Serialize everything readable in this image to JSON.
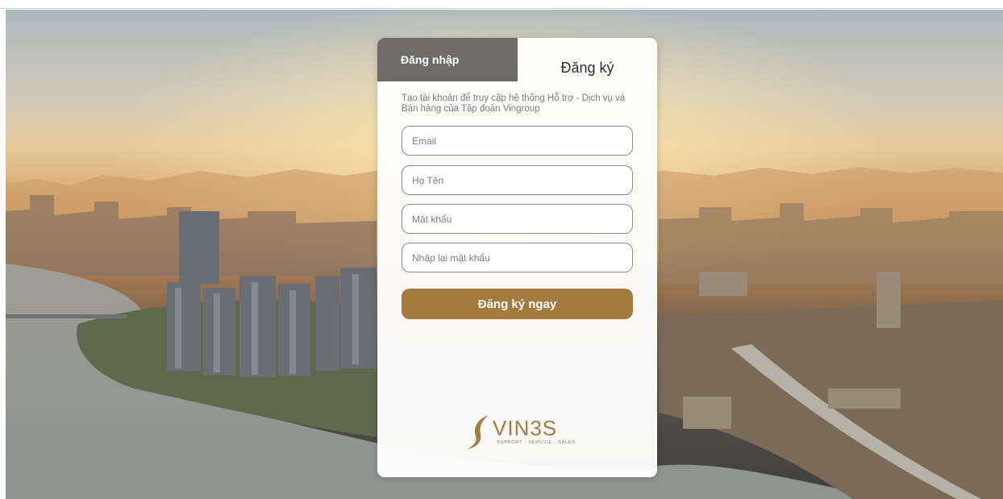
{
  "tabs": {
    "login": "Đăng nhập",
    "register": "Đăng ký",
    "active": "register"
  },
  "form": {
    "description": "Tạo tài khoản để truy cập hệ thống Hỗ trợ - Dịch vụ và Bán hàng của Tập đoàn Vingroup",
    "email_placeholder": "Email",
    "fullname_placeholder": "Họ Tên",
    "password_placeholder": "Mật khẩu",
    "confirm_password_placeholder": "Nhập lại mật khẩu",
    "submit_label": "Đăng ký ngay"
  },
  "brand": {
    "name": "VIN3S",
    "tagline": "SUPPORT · SERVICE · SALES",
    "accent_color": "#a57a3f",
    "tab_inactive_color": "#6e6c6b"
  },
  "background": {
    "icon": "city-skyline-photo"
  }
}
